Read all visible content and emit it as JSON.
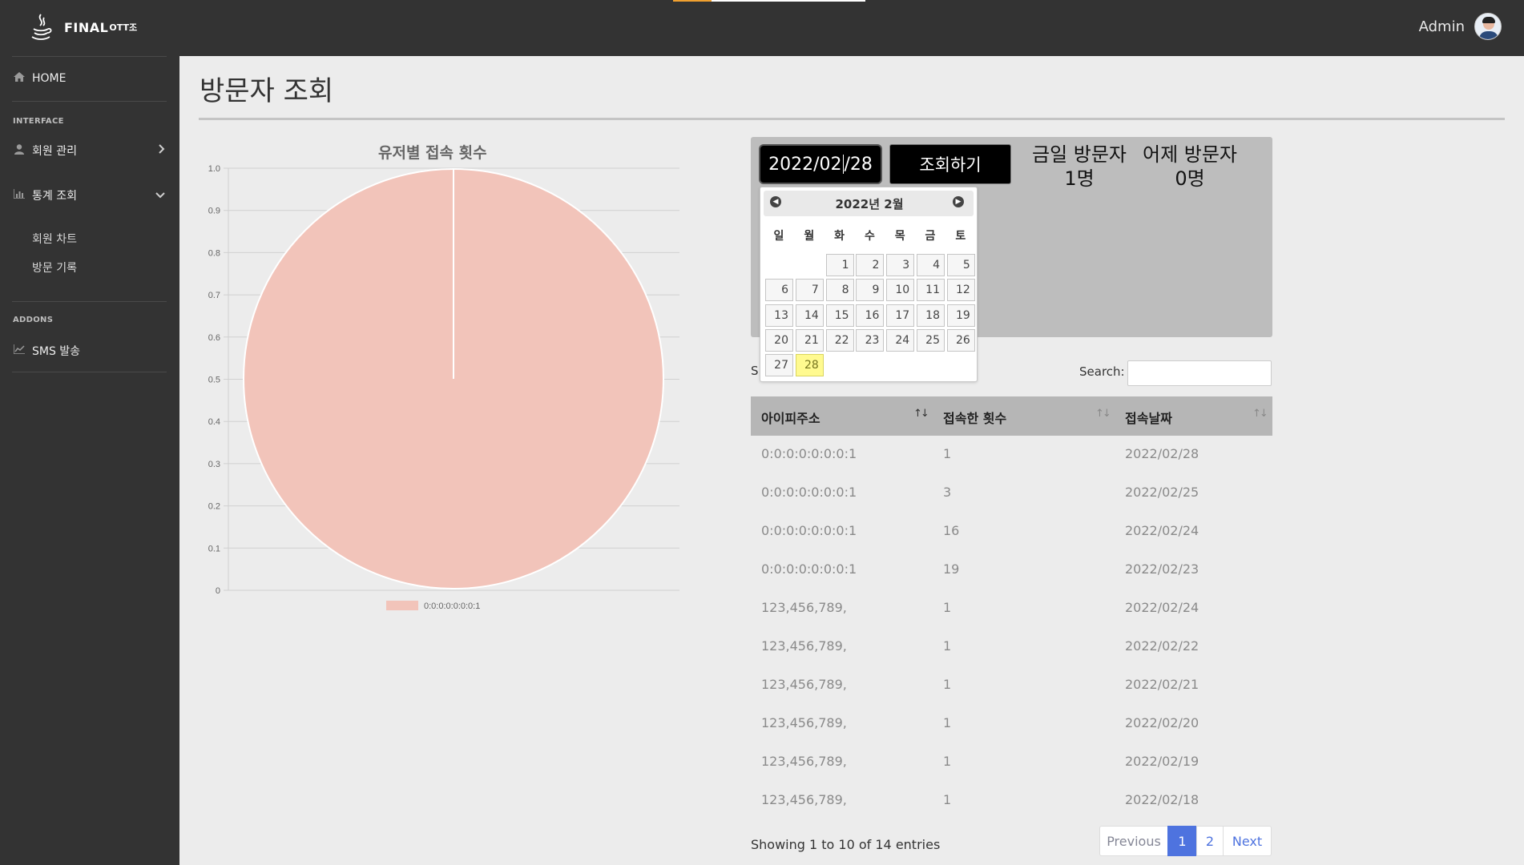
{
  "app": {
    "brand": "FINAL",
    "brand_sup": "OTT조",
    "user_name": "Admin"
  },
  "sidebar": {
    "home": "HOME",
    "interface_heading": "INTERFACE",
    "member_mgmt": "회원 관리",
    "stats": "통계 조회",
    "member_chart": "회원 차트",
    "visit_log": "방문 기록",
    "addons_heading": "ADDONS",
    "sms": "SMS 발송"
  },
  "page": {
    "title": "방문자 조회"
  },
  "chart_data": {
    "type": "pie",
    "title": "유저별 접속 횟수",
    "categories": [
      "0:0:0:0:0:0:0:1"
    ],
    "values": [
      1
    ],
    "colors": [
      "#f2c4ba"
    ],
    "axis_ticks": [
      "1.0",
      "0.9",
      "0.8",
      "0.7",
      "0.6",
      "0.5",
      "0.4",
      "0.3",
      "0.2",
      "0.1",
      "0"
    ],
    "ylim": [
      0,
      1.0
    ],
    "grid": true,
    "legend": "bottom"
  },
  "query": {
    "date_before_caret": "2022/02",
    "date_after_caret": "/28",
    "button": "조회하기",
    "today_label": "금일 방문자",
    "today_value": "1명",
    "yesterday_label": "어제 방문자",
    "yesterday_value": "0명"
  },
  "datepicker": {
    "title": "2022년 2월",
    "dow": [
      "일",
      "월",
      "화",
      "수",
      "목",
      "금",
      "토"
    ],
    "first_weekday": 2,
    "days_in_month": 28,
    "selected": 28
  },
  "table": {
    "length_label_partial": "S",
    "search_label": "Search:",
    "search_value": "",
    "columns": [
      "아이피주소",
      "접속한 횟수",
      "접속날짜"
    ],
    "rows": [
      [
        "0:0:0:0:0:0:0:1",
        "1",
        "2022/02/28"
      ],
      [
        "0:0:0:0:0:0:0:1",
        "3",
        "2022/02/25"
      ],
      [
        "0:0:0:0:0:0:0:1",
        "16",
        "2022/02/24"
      ],
      [
        "0:0:0:0:0:0:0:1",
        "19",
        "2022/02/23"
      ],
      [
        "123,456,789,",
        "1",
        "2022/02/24"
      ],
      [
        "123,456,789,",
        "1",
        "2022/02/22"
      ],
      [
        "123,456,789,",
        "1",
        "2022/02/21"
      ],
      [
        "123,456,789,",
        "1",
        "2022/02/20"
      ],
      [
        "123,456,789,",
        "1",
        "2022/02/19"
      ],
      [
        "123,456,789,",
        "1",
        "2022/02/18"
      ]
    ],
    "info": "Showing 1 to 10 of 14 entries",
    "pagination": {
      "previous": "Previous",
      "pages": [
        "1",
        "2"
      ],
      "next": "Next",
      "current": "1"
    }
  },
  "colors": {
    "sidebar_bg": "#333333",
    "topbar_bg": "#333333",
    "page_bg": "#ececec",
    "accent": "#4e73df",
    "selected_day": "#fffa90"
  },
  "icons": {
    "home": "home-icon",
    "member": "user-icon",
    "stats": "chart-icon",
    "sms": "chart-icon"
  }
}
